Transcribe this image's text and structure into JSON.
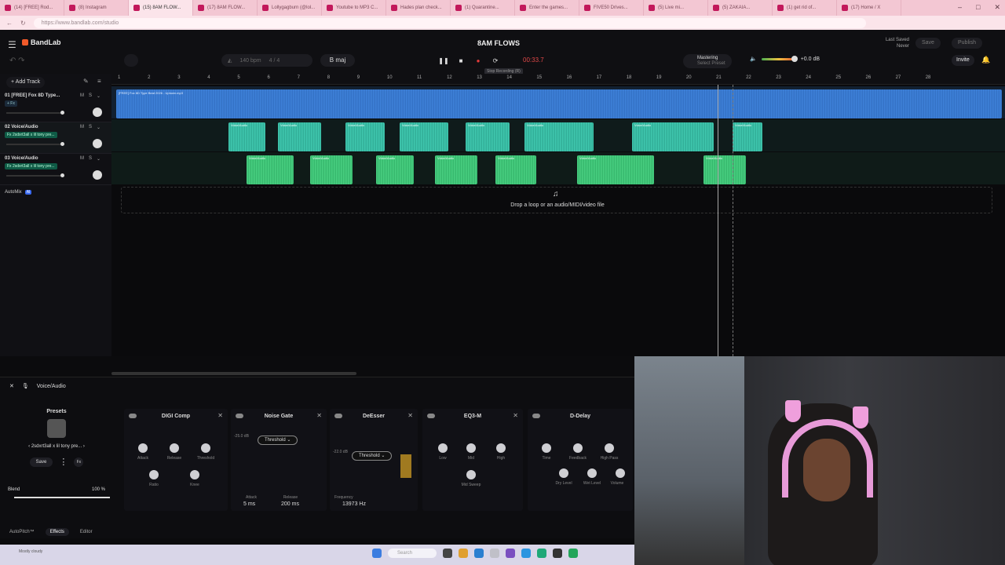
{
  "browser": {
    "tabs": [
      {
        "label": "(14) [FREE] Rod...",
        "active": false
      },
      {
        "label": "(8) Instagram",
        "active": false
      },
      {
        "label": "(15) 8AM FLOW...",
        "active": true
      },
      {
        "label": "(17) 8AM FLOW...",
        "active": false
      },
      {
        "label": "Lollygagburn (@lol...",
        "active": false
      },
      {
        "label": "Youtube to MP3 C...",
        "active": false
      },
      {
        "label": "Hades plan check...",
        "active": false
      },
      {
        "label": "(1) Quarantine...",
        "active": false
      },
      {
        "label": "Enter the games...",
        "active": false
      },
      {
        "label": "FIVE50 Drives...",
        "active": false
      },
      {
        "label": "(5) Live mi...",
        "active": false
      },
      {
        "label": "(5) ZAKAIA...",
        "active": false
      },
      {
        "label": "(1) get rid of...",
        "active": false
      },
      {
        "label": "(17) Home / X",
        "active": false
      }
    ],
    "url": "https://www.bandlab.com/studio"
  },
  "header": {
    "app_name": "BandLab",
    "project_title": "8AM FLOWS",
    "last_saved_label": "Last Saved",
    "last_saved_value": "Never",
    "save_label": "Save",
    "publish_label": "Publish",
    "tempo": "140 bpm",
    "time_signature": "4 / 4",
    "key": "B maj",
    "timecode": "00:33.7",
    "tooltip": "Stop Recording (R)",
    "mastering_label": "Mastering",
    "mastering_sub": "Select Preset",
    "master_volume": "+0.0 dB",
    "invite_label": "Invite"
  },
  "tracks": {
    "add_label": "Add Track",
    "items": [
      {
        "name": "01  [FREE] Fox 8D Type...",
        "fx": "+ Fx",
        "color": "#3a7fd8"
      },
      {
        "name": "02  Voice/Audio",
        "fx": "Fx 2sdxrt3all x lil tony pre...",
        "color": "#2ab49b"
      },
      {
        "name": "03  Voice/Audio",
        "fx": "Fx 2sdxrt3all x lil tony pre...",
        "color": "#2fbf6c"
      }
    ],
    "automix_label": "AutoMix",
    "automix_badge": "AI"
  },
  "ruler": [
    "1",
    "2",
    "3",
    "4",
    "5",
    "6",
    "7",
    "8",
    "9",
    "10",
    "11",
    "12",
    "13",
    "14",
    "15",
    "16",
    "17",
    "18",
    "19",
    "20",
    "21",
    "22",
    "23",
    "24",
    "25",
    "26",
    "27",
    "28"
  ],
  "arrangement": {
    "master_clip_label": "[FREE] Fox 8D Type Beat 2026 - Uptown.mp3",
    "clip_label": "Voice/Audio",
    "drop_hint": "Drop a loop or an audio/MIDI/video file"
  },
  "fx_panel": {
    "track_label": "Voice/Audio",
    "presets_title": "Presets",
    "preset_name": "2sdxrt3all x lil tony pre...",
    "save_label": "Save",
    "fx_label": "Fx",
    "blend_label": "Blend",
    "blend_value": "100 %",
    "units": [
      {
        "title": "DIGI Comp",
        "knobs": [
          "Attack",
          "Release",
          "Threshold",
          "Ratio",
          "Knee"
        ]
      },
      {
        "title": "Noise Gate",
        "db": "-25.0 dB",
        "threshold": "Threshold",
        "attack_label": "Attack",
        "attack_value": "5 ms",
        "release_label": "Release",
        "release_value": "200 ms"
      },
      {
        "title": "DeEsser",
        "db": "-22.0 dB",
        "threshold": "Threshold",
        "freq_label": "Frequency",
        "freq_value": "13973 Hz"
      },
      {
        "title": "EQ3-M",
        "knobs": [
          "Low",
          "Mid",
          "High",
          "Mid Sweep"
        ]
      },
      {
        "title": "D-Delay",
        "knobs": [
          "Time",
          "Feedback",
          "High Pass",
          "Dry Level",
          "Wet Level",
          "Volume"
        ]
      }
    ],
    "bottom_tabs": [
      "AutoPitch™",
      "Effects",
      "Editor"
    ]
  },
  "taskbar": {
    "weather": "Mostly cloudy",
    "search_placeholder": "Search"
  }
}
